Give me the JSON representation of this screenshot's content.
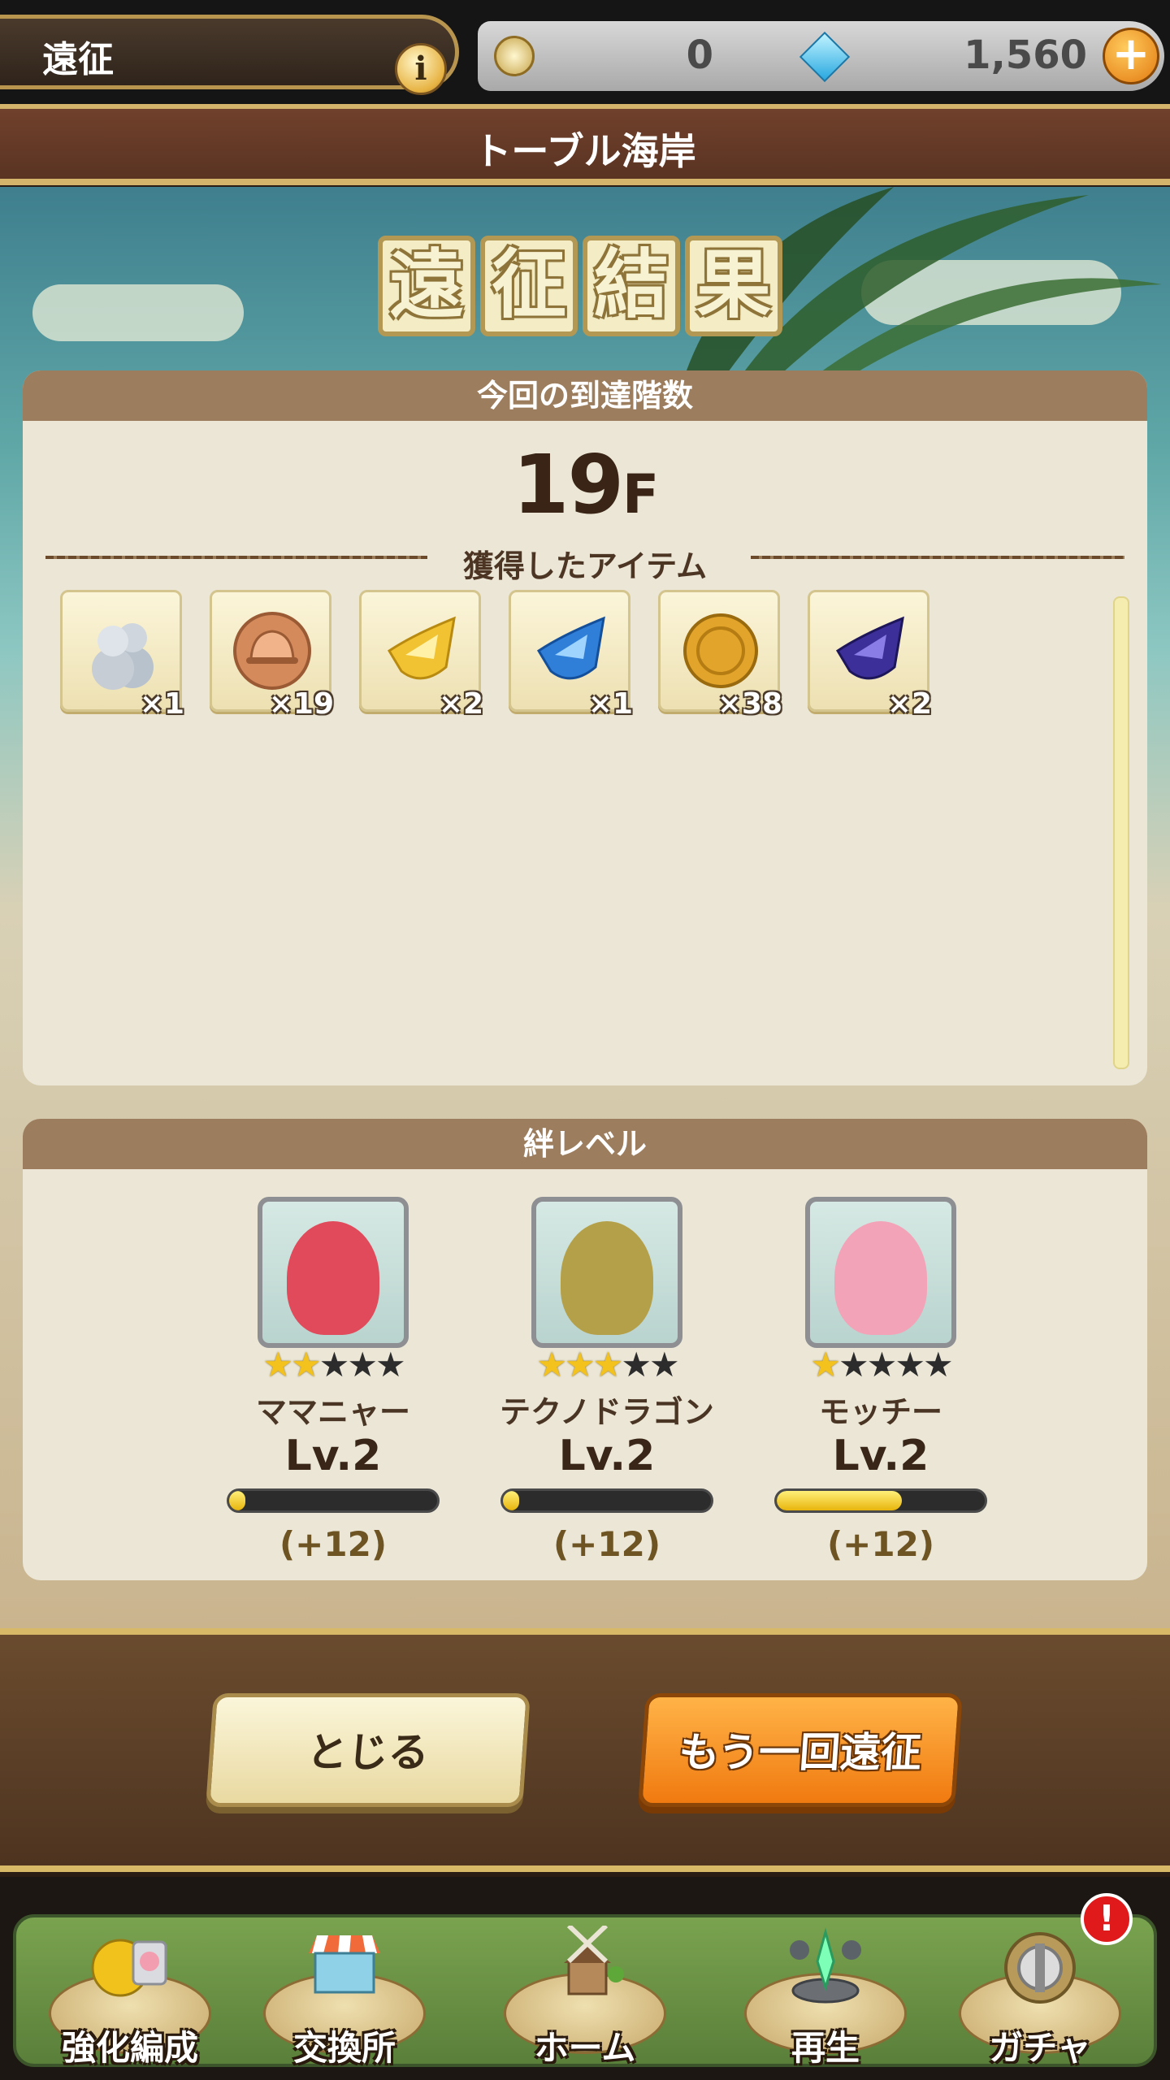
{
  "header": {
    "mode_title": "遠征",
    "info_label": "i",
    "currency1_value": "0",
    "currency2_value": "1,560",
    "add_label": "+"
  },
  "location_name": "トーブル海岸",
  "result_title_chars": [
    "遠",
    "征",
    "結",
    "果"
  ],
  "floors_panel": {
    "header": "今回の到達階数",
    "floor_number": "19",
    "floor_unit": "F",
    "items_label": "獲得したアイテム",
    "items": [
      {
        "icon": "teru-teru-doll-icon",
        "count": "×1"
      },
      {
        "icon": "bronze-helmet-coin-icon",
        "count": "×19"
      },
      {
        "icon": "gold-crystal-shard-icon",
        "count": "×2"
      },
      {
        "icon": "blue-crystal-shard-icon",
        "count": "×1"
      },
      {
        "icon": "gold-coin-icon",
        "count": "×38"
      },
      {
        "icon": "purple-crystal-shard-icon",
        "count": "×2"
      }
    ]
  },
  "bond_panel": {
    "header": "絆レベル",
    "characters": [
      {
        "name": "ママニャー",
        "level": "Lv.2",
        "gain": "(+12)",
        "stars": 2,
        "max_stars": 5,
        "progress": 0.08,
        "portrait_color": "#e04a5a"
      },
      {
        "name": "テクノドラゴン",
        "level": "Lv.2",
        "gain": "(+12)",
        "stars": 3,
        "max_stars": 5,
        "progress": 0.08,
        "portrait_color": "#b5a04a"
      },
      {
        "name": "モッチー",
        "level": "Lv.2",
        "gain": "(+12)",
        "stars": 1,
        "max_stars": 5,
        "progress": 0.6,
        "portrait_color": "#f3a3b8"
      }
    ]
  },
  "buttons": {
    "close_label": "とじる",
    "again_label": "もう一回遠征"
  },
  "nav": {
    "items": [
      {
        "label": "強化編成",
        "icon": "upgrade-team-icon"
      },
      {
        "label": "交換所",
        "icon": "exchange-shop-icon"
      },
      {
        "label": "ホーム",
        "icon": "home-windmill-icon"
      },
      {
        "label": "再生",
        "icon": "revive-icon"
      },
      {
        "label": "ガチャ",
        "icon": "gacha-icon"
      }
    ],
    "alert_label": "!"
  },
  "colors": {
    "accent_orange": "#f07a10",
    "gold_border": "#d4b46a",
    "panel_header": "#9c7d5d"
  }
}
